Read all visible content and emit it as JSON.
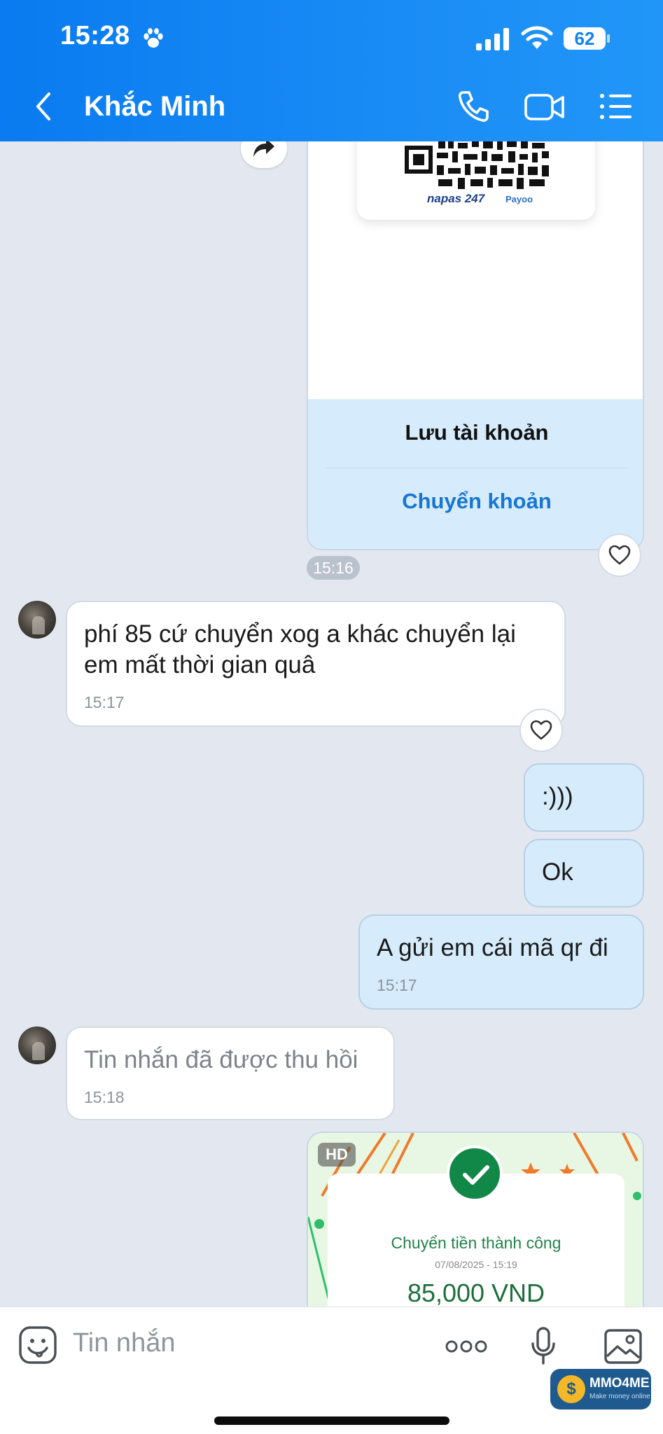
{
  "status_bar": {
    "time": "15:28",
    "battery": "62"
  },
  "header": {
    "contact_name": "Khắc Minh"
  },
  "bank_card": {
    "napas": "napas 247",
    "payoo": "Payoo",
    "save_label": "Lưu tài khoản",
    "transfer_label": "Chuyển khoản",
    "time": "15:16"
  },
  "messages": [
    {
      "direction": "in",
      "lines": [
        "phí 85 cứ chuyển xog a khác chuyển lại",
        "em mất thời gian quâ"
      ],
      "time": "15:17"
    },
    {
      "direction": "out",
      "text": ":)))"
    },
    {
      "direction": "out",
      "text": "Ok"
    },
    {
      "direction": "out",
      "text": "A gửi em cái mã qr đi",
      "time": "15:17"
    },
    {
      "direction": "in",
      "text": "Tin nhắn đã được thu hồi",
      "time": "15:18"
    }
  ],
  "receipt": {
    "badge": "HD",
    "title": "Chuyển tiền thành công",
    "date": "07/08/2025 - 15:19",
    "amount": "85,000 VND"
  },
  "composer": {
    "placeholder": "Tin nhắn"
  },
  "watermark": {
    "name": "MMO4ME",
    "tagline": "Make money online",
    "coin": "$"
  }
}
